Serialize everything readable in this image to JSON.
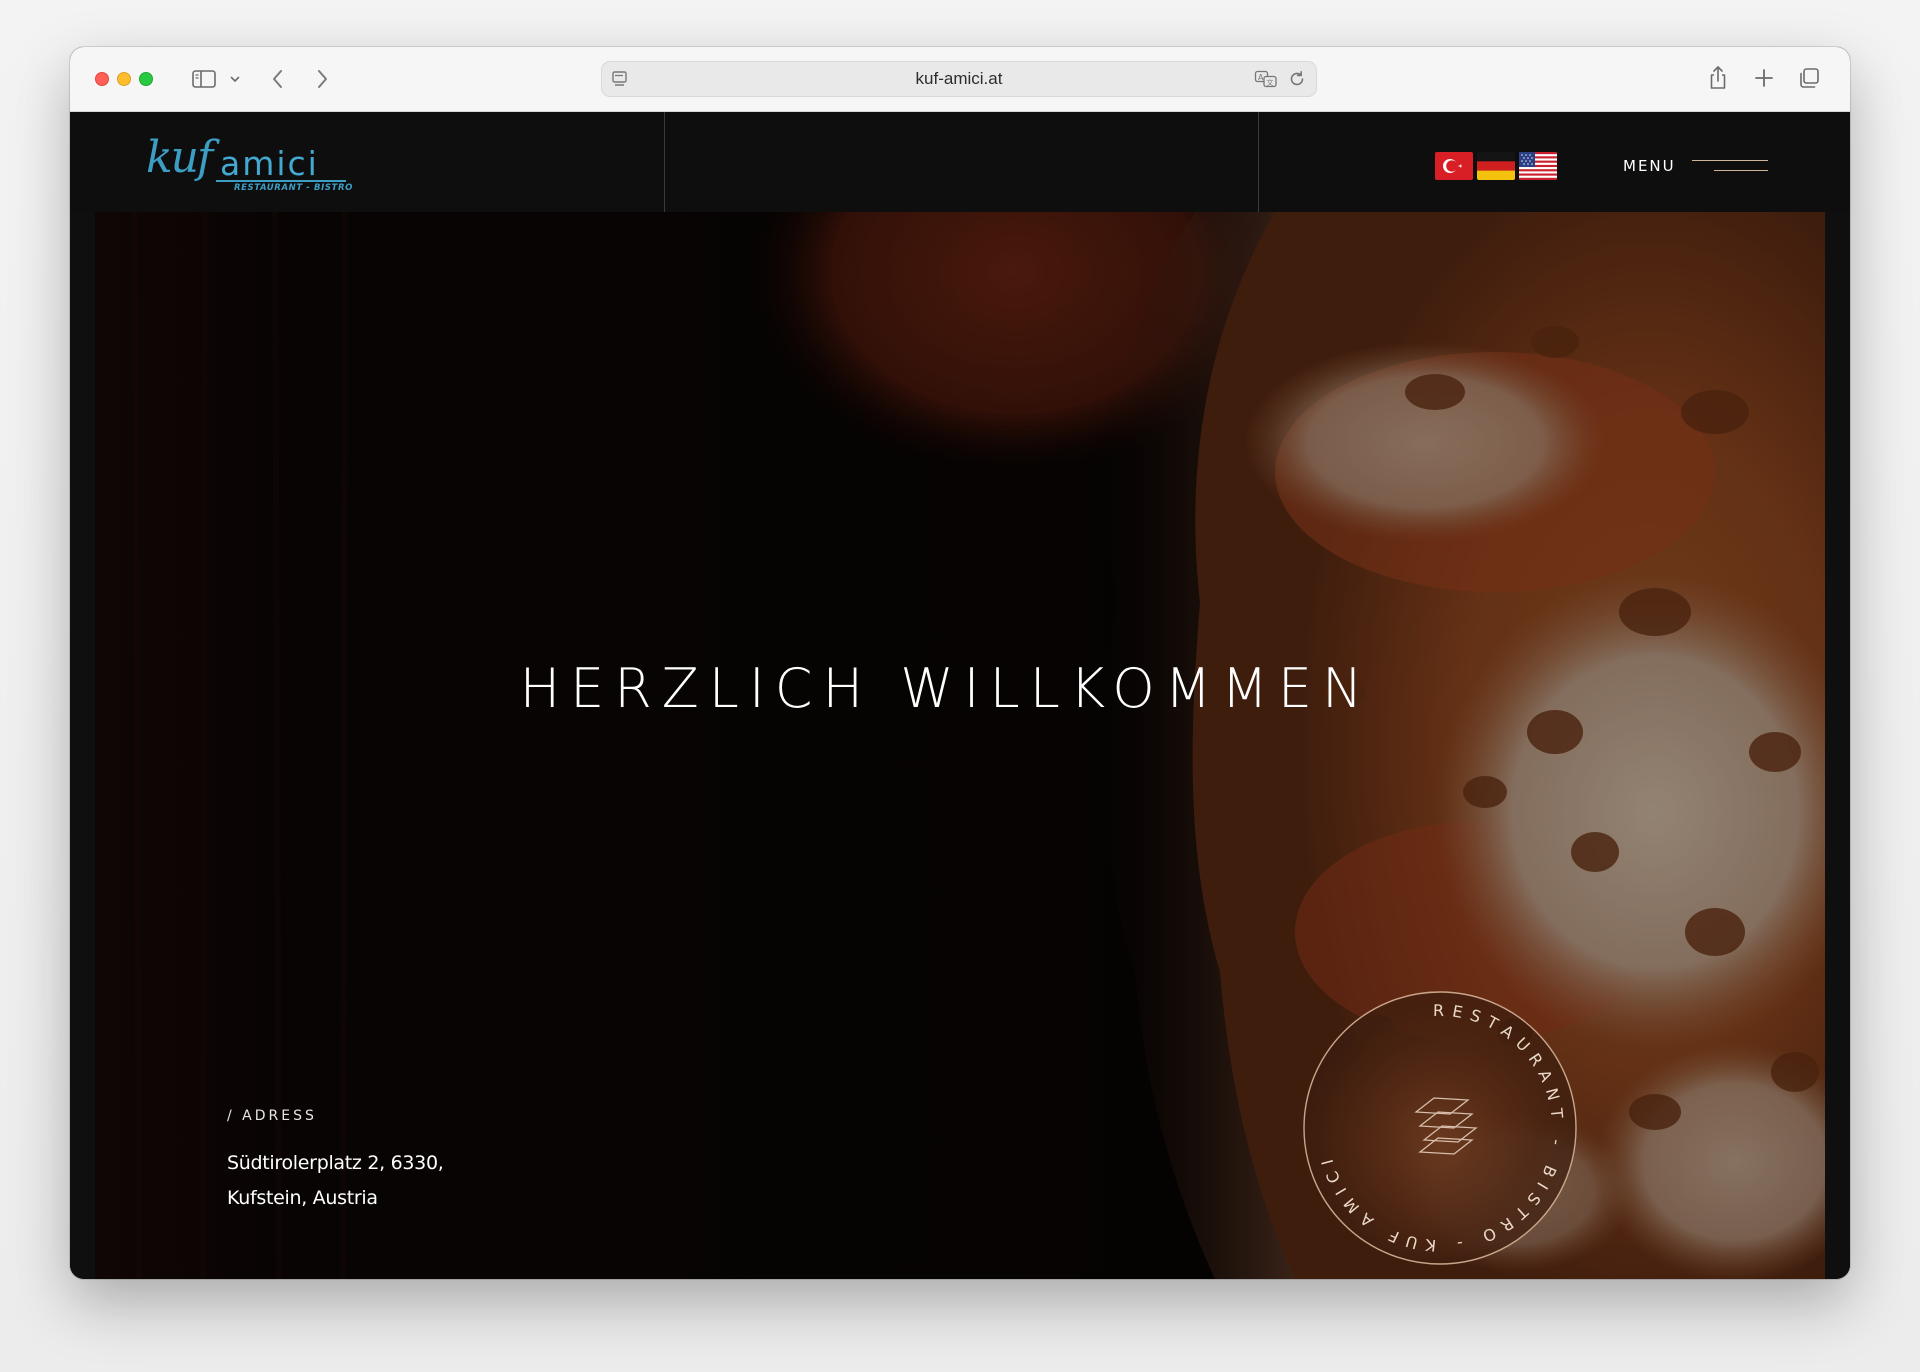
{
  "browser": {
    "url": "kuf-amici.at",
    "icons": [
      "sidebar-icon",
      "chevron-down-icon",
      "back-icon",
      "forward-icon",
      "page-icon",
      "translate-icon",
      "reload-icon",
      "share-icon",
      "plus-icon",
      "tabs-icon"
    ]
  },
  "header": {
    "logo": {
      "script": "kuf",
      "name": "amici",
      "tagline": "RESTAURANT - BISTRO"
    },
    "languages": [
      {
        "code": "tr",
        "icon": "flag-turkey-icon"
      },
      {
        "code": "de",
        "icon": "flag-germany-icon"
      },
      {
        "code": "en",
        "icon": "flag-usa-icon"
      }
    ],
    "menu_label": "MENU"
  },
  "hero": {
    "title": "HERZLICH WILLKOMMEN",
    "address_label": "/ ADRESS",
    "address_line_1": "Südtirolerplatz 2, 6330,",
    "address_line_2": "Kufstein, Austria",
    "badge_text": "RESTAURANT - BISTRO - KUF AMICI"
  },
  "colors": {
    "logo_blue": "#3d9ec4",
    "accent_tan": "#d0b49a",
    "background": "#0e0e0e"
  }
}
